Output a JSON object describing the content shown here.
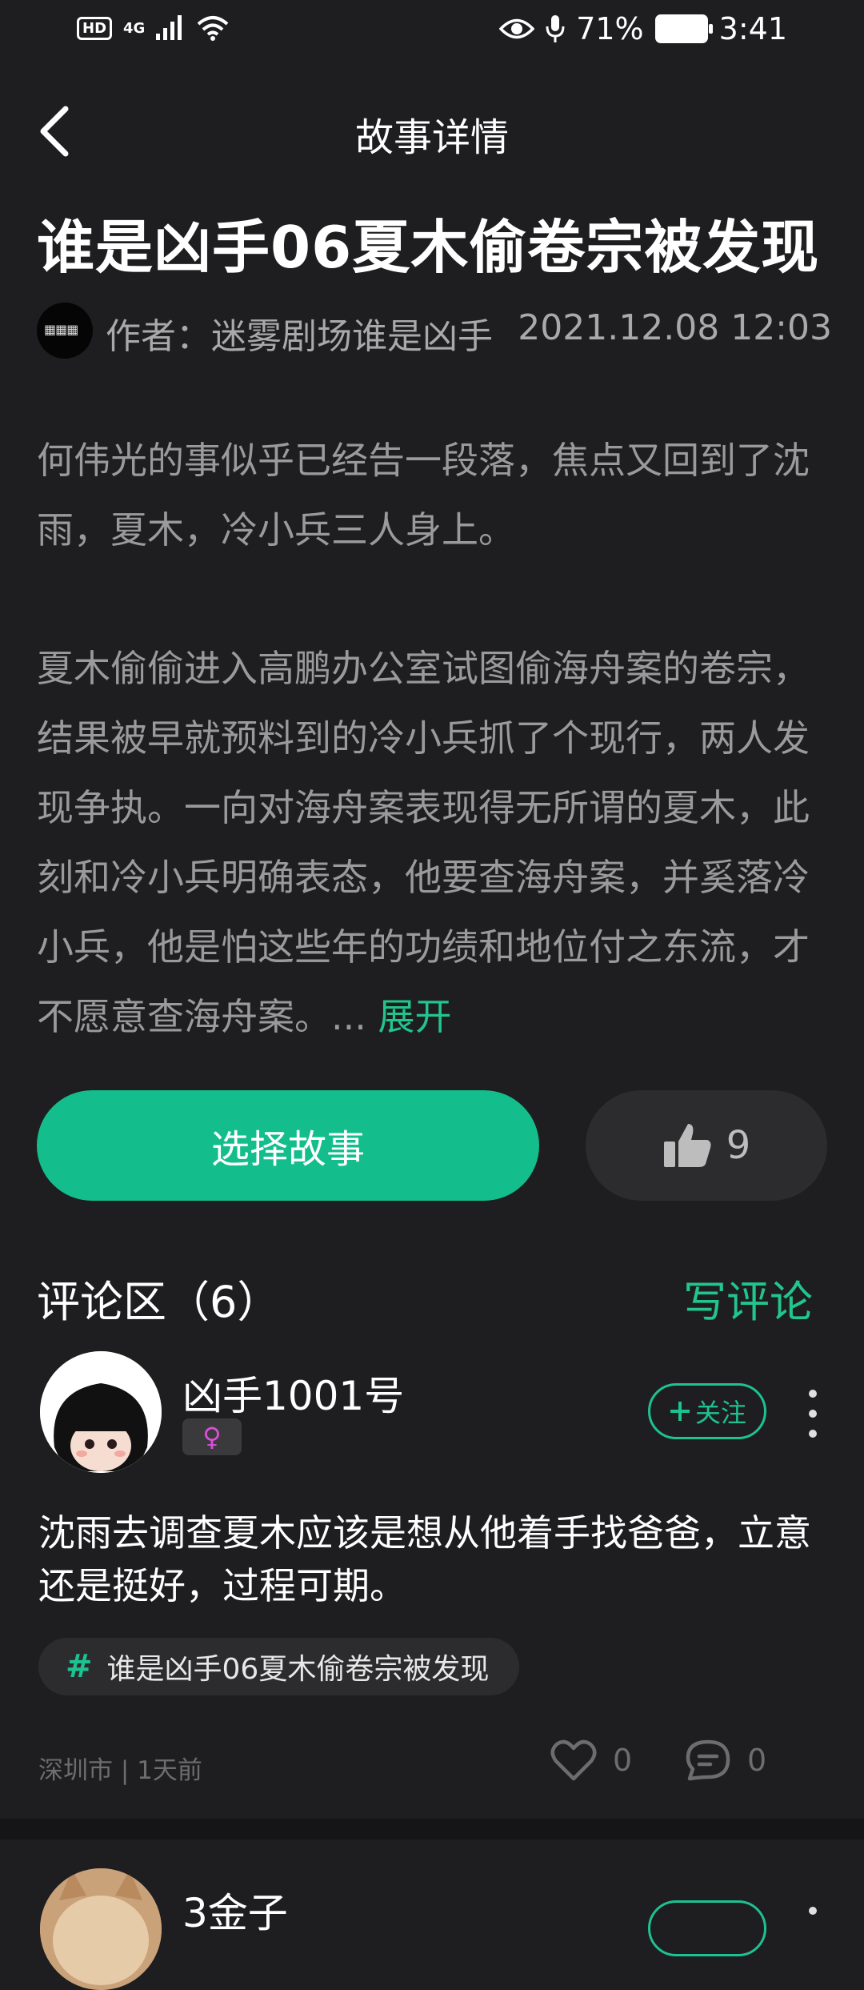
{
  "status_bar": {
    "network": "4G",
    "hd": "HD",
    "battery": "71%",
    "time": "3:41"
  },
  "nav": {
    "title": "故事详情"
  },
  "story": {
    "title": "谁是凶手06夏木偷卷宗被发现",
    "author": "作者：迷雾剧场谁是凶手",
    "date": "2021.12.08 12:03",
    "paragraph1": "何伟光的事似乎已经告一段落，焦点又回到了沈雨，夏木，冷小兵三人身上。",
    "paragraph2": "夏木偷偷进入高鹏办公室试图偷海舟案的卷宗，结果被早就预料到的冷小兵抓了个现行，两人发现争执。一向对海舟案表现得无所谓的夏木，此刻和冷小兵明确表态，他要查海舟案，并奚落冷小兵，他是怕这些年的功绩和地位付之东流，才不愿意查海舟案。... ",
    "expand_label": "展开"
  },
  "actions": {
    "select_story": "选择故事",
    "like_count": "9"
  },
  "comments_section": {
    "header": "评论区（6）",
    "write_comment": "写评论",
    "comments": [
      {
        "username": "凶手1001号",
        "gender_symbol": "♀",
        "follow_label": "关注",
        "text": "沈雨去调查夏木应该是想从他着手找爸爸，立意还是挺好，过程可期。",
        "tag": "谁是凶手06夏木偷卷宗被发现",
        "meta": "深圳市 | 1天前",
        "likes": "0",
        "replies": "0"
      },
      {
        "username": "3金子"
      }
    ]
  },
  "colors": {
    "accent": "#14bd8c",
    "background": "#1e1e20",
    "muted_text": "#9a9a9c"
  }
}
